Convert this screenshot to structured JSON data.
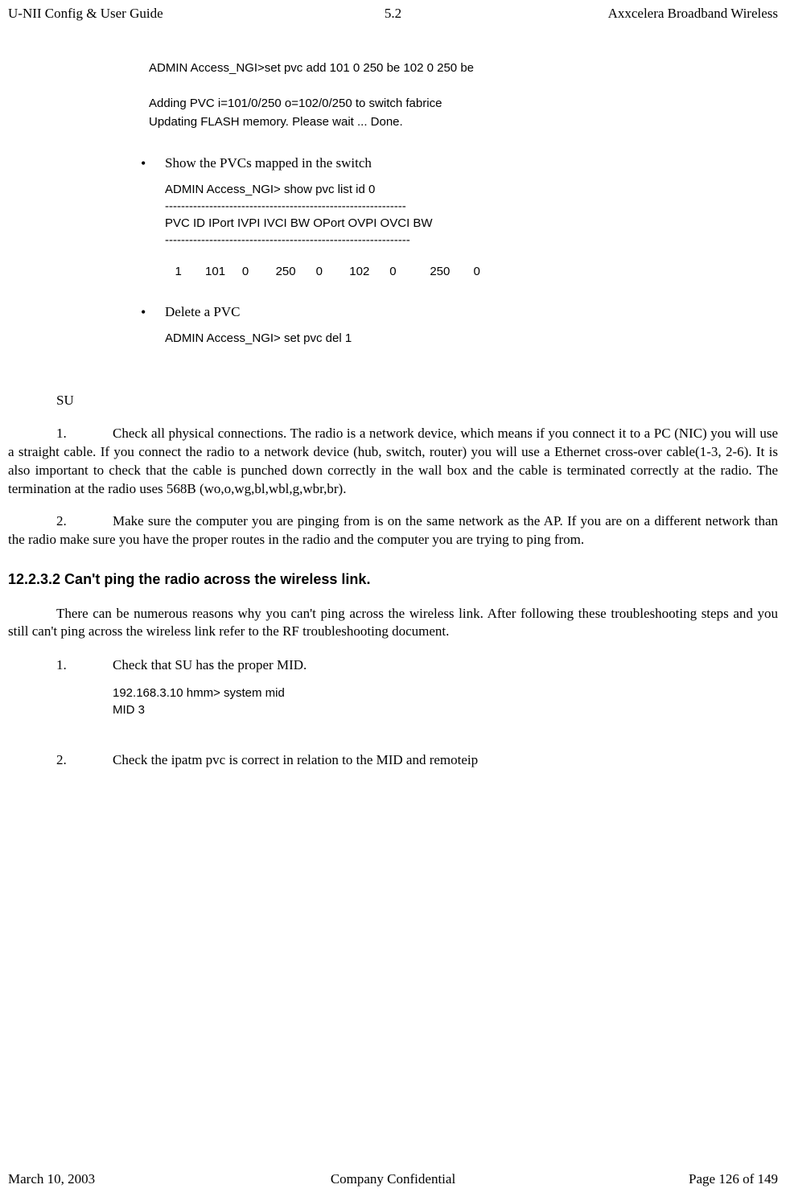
{
  "header": {
    "left": "U-NII Config & User Guide",
    "center": "5.2",
    "right": "Axxcelera Broadband Wireless"
  },
  "code_block1": {
    "line1": "ADMIN Access_NGI>set   pvc   add   101   0   250   be   102   0   250   be",
    "line2": "Adding PVC i=101/0/250 o=102/0/250  to switch fabrice",
    "line3": "Updating FLASH memory. Please wait ... Done."
  },
  "bullet1": {
    "text": "Show the PVCs mapped in the switch",
    "cmd": "ADMIN Access_NGI>   show   pvc   list   id   0",
    "sep1": "   ------------------------------------------------------------",
    "header_row": "    PVC ID  IPort   IVPI   IVCI    BW    OPort  OVPI   OVCI    BW",
    "sep2": "-------------------------------------------------------------",
    "data_row": "   1       101     0        250      0        102      0          250       0"
  },
  "bullet2": {
    "text": "Delete a PVC",
    "cmd": "ADMIN Access_NGI>   set   pvc   del   1"
  },
  "su_section": {
    "title": "SU",
    "step1_num": "1.",
    "step1_text": "Check all physical connections. The radio is a network device, which means if you connect it to a PC (NIC) you will use a straight cable. If you connect the radio to a network device (hub, switch, router) you will use a Ethernet cross-over cable(1-3, 2-6). It is also important to check that the cable is punched down correctly in the wall box and the cable is terminated correctly at the radio.  The termination at the radio uses 568B (wo,o,wg,bl,wbl,g,wbr,br).",
    "step2_num": "2.",
    "step2_text": "Make sure the computer you are pinging from is on the same network as the AP. If you are on a different network than the radio make sure you have the proper routes in the radio and the computer you are trying to ping from."
  },
  "section_12_2_3_2": {
    "heading": "12.2.3.2      Can't ping the radio across the wireless link.",
    "intro": "There can be numerous reasons why you can't ping across the wireless link. After following these troubleshooting steps and you still can't ping across the wireless link refer to the RF troubleshooting document.",
    "step1_num": "1.",
    "step1_text": "Check that SU has the proper MID.",
    "step1_code1": "192.168.3.10 hmm>   system   mid",
    "step1_code2": "MID 3",
    "step2_num": "2.",
    "step2_text": "Check the ipatm pvc is correct in relation to the MID and remoteip"
  },
  "footer": {
    "left": "March 10, 2003",
    "center": "Company Confidential",
    "right": "Page 126 of 149"
  }
}
